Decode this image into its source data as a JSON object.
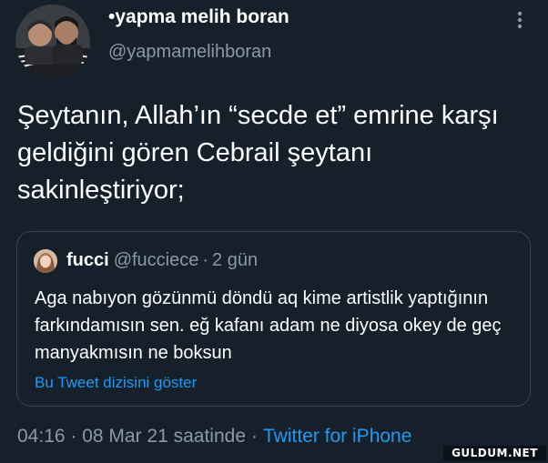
{
  "author": {
    "display_name": "•yapma melih boran",
    "handle": "@yapmamelihboran",
    "avatar_icon": "profile-photo"
  },
  "more_icon": "vertical-ellipsis-icon",
  "tweet": {
    "text": "Şeytanın, Allah’ın “secde et” emrine karşı geldiğini gören Cebrail şeytanı sakinleştiriyor;"
  },
  "quote": {
    "name": "fucci",
    "handle": "@fucciece",
    "separator": "·",
    "time": "2 gün",
    "text": "Aga nabıyon gözünmü döndü aq kime artistlik yaptığının farkındamısın sen. eğ kafanı adam ne diyosa okey de geç manyakmısın ne boksun",
    "thread_link": "Bu Tweet dizisini göster"
  },
  "meta": {
    "timestamp": "04:16 · 08 Mar 21 saatinde",
    "separator": "·",
    "source": "Twitter for iPhone"
  },
  "watermark": "GULDUM.NET",
  "colors": {
    "background": "#15202b",
    "primary_text": "#ffffff",
    "secondary_text": "#8b98a5",
    "link": "#1d9bf0",
    "border": "#38444d"
  }
}
